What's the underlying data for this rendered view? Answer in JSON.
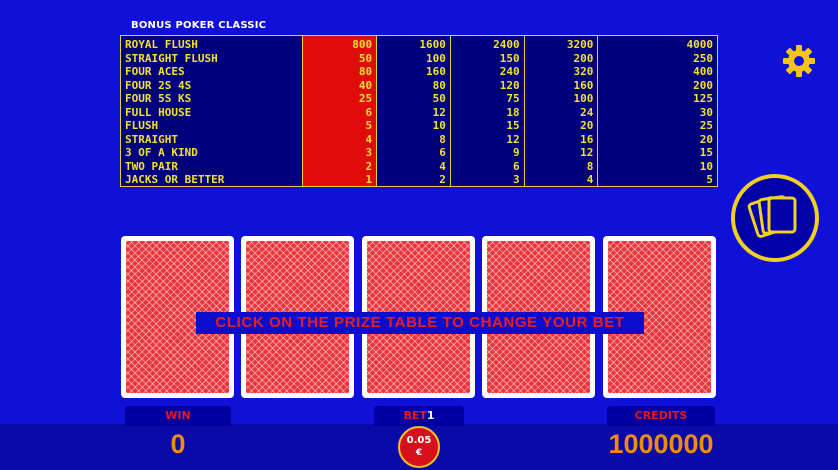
{
  "game_title": "BONUS POKER CLASSIC",
  "paytable": {
    "hands": [
      "ROYAL FLUSH",
      "STRAIGHT FLUSH",
      "FOUR ACES",
      "FOUR 2S  4S",
      "FOUR 5S  KS",
      "FULL HOUSE",
      "FLUSH",
      "STRAIGHT",
      "3 OF A KIND",
      "TWO PAIR",
      "JACKS OR BETTER"
    ],
    "selected_column": 1,
    "columns": [
      [
        "800",
        "50",
        "80",
        "40",
        "25",
        "6",
        "5",
        "4",
        "3",
        "2",
        "1"
      ],
      [
        "1600",
        "100",
        "160",
        "80",
        "50",
        "12",
        "10",
        "8",
        "6",
        "4",
        "2"
      ],
      [
        "2400",
        "150",
        "240",
        "120",
        "75",
        "18",
        "15",
        "12",
        "9",
        "6",
        "3"
      ],
      [
        "3200",
        "200",
        "320",
        "160",
        "100",
        "24",
        "20",
        "16",
        "12",
        "8",
        "4"
      ],
      [
        "4000",
        "250",
        "400",
        "200",
        "125",
        "30",
        "25",
        "20",
        "15",
        "10",
        "5"
      ]
    ]
  },
  "message": "CLICK ON THE PRIZE TABLE TO CHANGE YOUR BET",
  "win": {
    "label": "WIN",
    "value": "0"
  },
  "bet": {
    "label": "BET",
    "level": "1",
    "coin_value": "0.05",
    "currency": "€"
  },
  "credits": {
    "label": "CREDITS",
    "value": "1000000"
  },
  "icons": {
    "settings": "gear-icon",
    "deal": "cards-icon"
  },
  "colors": {
    "background": "#1010d8",
    "paytable_text": "#f2e030",
    "selected_column": "#e00c0c",
    "message": "#e8201c",
    "counter": "#f08a10"
  }
}
